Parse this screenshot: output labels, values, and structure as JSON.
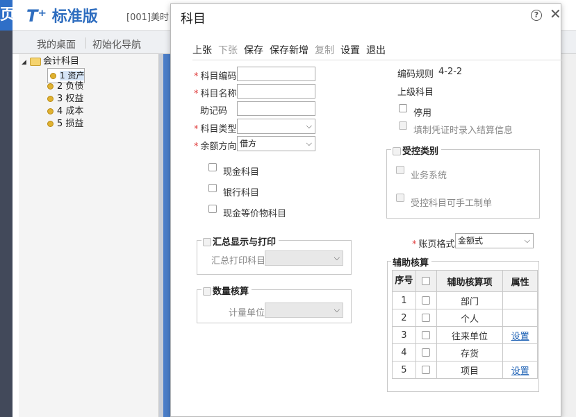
{
  "app": {
    "logo_t": "T⁺",
    "logo_text": "标准版",
    "company": "[001]美时",
    "left_glyph": "页"
  },
  "nav": {
    "tabs": [
      "我的桌面",
      "初始化导航"
    ]
  },
  "tree": {
    "root": "会计科目",
    "items": [
      "1 资产",
      "2 负债",
      "3 权益",
      "4 成本",
      "5 损益"
    ]
  },
  "dialog": {
    "title": "科目",
    "help": "?",
    "close": "✕",
    "toolbar": {
      "prev": "上张",
      "next": "下张",
      "save": "保存",
      "save_new": "保存新增",
      "copy": "复制",
      "settings": "设置",
      "exit": "退出"
    },
    "fields": {
      "code_label": "科目编码",
      "name_label": "科目名称",
      "mnemonic_label": "助记码",
      "type_label": "科目类型",
      "direction_label": "余额方向",
      "direction_value": "借方",
      "coding_rule_label": "编码规则",
      "coding_rule_value": "4-2-2",
      "parent_label": "上级科目"
    },
    "checks": {
      "disabled": "停用",
      "settlement": "填制凭证时录入结算信息",
      "cash": "现金科目",
      "bank": "银行科目",
      "cash_eq": "现金等价物科目"
    },
    "controlled": {
      "title": "受控类别",
      "business": "业务系统",
      "manual": "受控科目可手工制单"
    },
    "summary": {
      "title": "汇总显示与打印",
      "print_label": "汇总打印科目"
    },
    "quantity": {
      "title": "数量核算",
      "unit_label": "计量单位"
    },
    "ledger": {
      "label": "账页格式",
      "value": "金额式"
    },
    "aux": {
      "title": "辅助核算",
      "headers": {
        "seq": "序号",
        "item": "辅助核算项",
        "attr": "属性"
      },
      "rows": [
        {
          "seq": "1",
          "item": "部门",
          "attr": ""
        },
        {
          "seq": "2",
          "item": "个人",
          "attr": ""
        },
        {
          "seq": "3",
          "item": "往来单位",
          "attr": "设置"
        },
        {
          "seq": "4",
          "item": "存货",
          "attr": ""
        },
        {
          "seq": "5",
          "item": "项目",
          "attr": "设置"
        }
      ]
    }
  }
}
